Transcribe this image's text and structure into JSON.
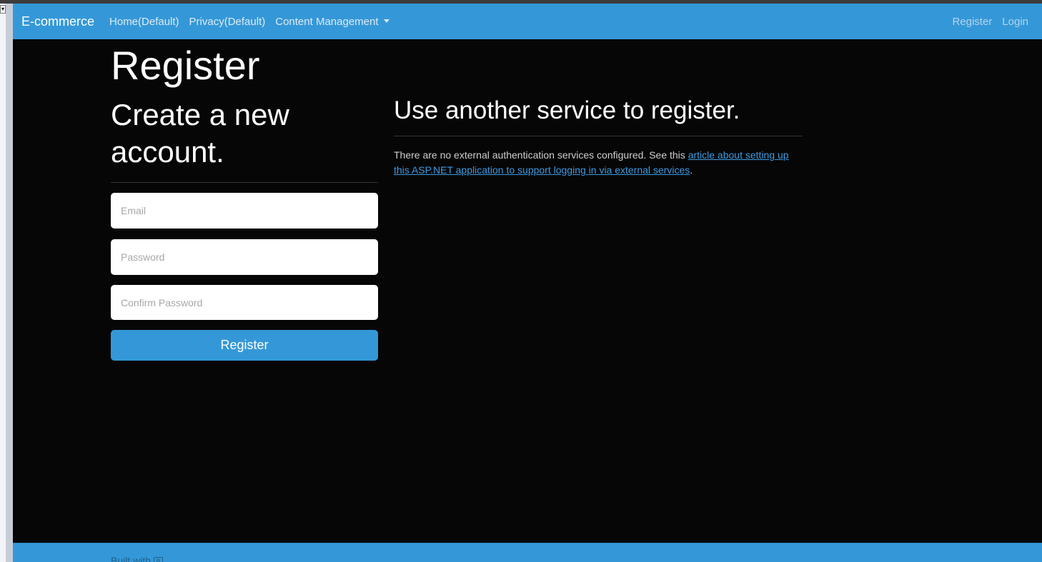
{
  "navbar": {
    "brand": "E-commerce",
    "links": [
      "Home(Default)",
      "Privacy(Default)",
      "Content Management"
    ],
    "right_links": [
      "Register",
      "Login"
    ],
    "background_color": "#3498d8"
  },
  "main": {
    "title": "Register",
    "left": {
      "subtitle": "Create a new account.",
      "fields": {
        "email_placeholder": "Email",
        "password_placeholder": "Password",
        "confirm_placeholder": "Confirm Password"
      },
      "submit_label": "Register"
    },
    "right": {
      "heading": "Use another service to register.",
      "text_before": "There are no external authentication services configured. See this ",
      "link_text": "article about setting up this ASP.NET application to support logging in via external services",
      "text_after": "."
    }
  },
  "footer": {
    "text": "Built with"
  }
}
